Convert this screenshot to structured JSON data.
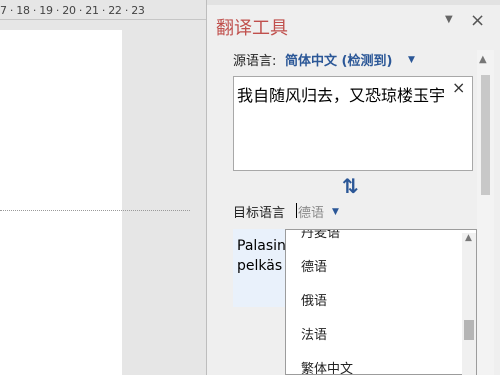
{
  "ruler": {
    "text": "7 · 18 · 19 · 20 · 21 · 22 · 23"
  },
  "pane": {
    "title": "翻译工具",
    "menu_icon": "chevron-down-icon",
    "close_label": "×"
  },
  "source": {
    "label": "源语言:",
    "value": "简体中文 (检测到)",
    "text": "我自随风归去，又恐琼楼玉宇",
    "clear_label": "×"
  },
  "swap_label": "⇅",
  "target": {
    "label": "目标语言",
    "value": "德语",
    "text_lines": [
      "Palasin",
      "pelkäs"
    ]
  },
  "dropdown": {
    "items": [
      "丹麦语",
      "德语",
      "俄语",
      "法语",
      "繁体中文"
    ]
  },
  "colors": {
    "accent": "#2b5797",
    "title": "#c0504d"
  }
}
